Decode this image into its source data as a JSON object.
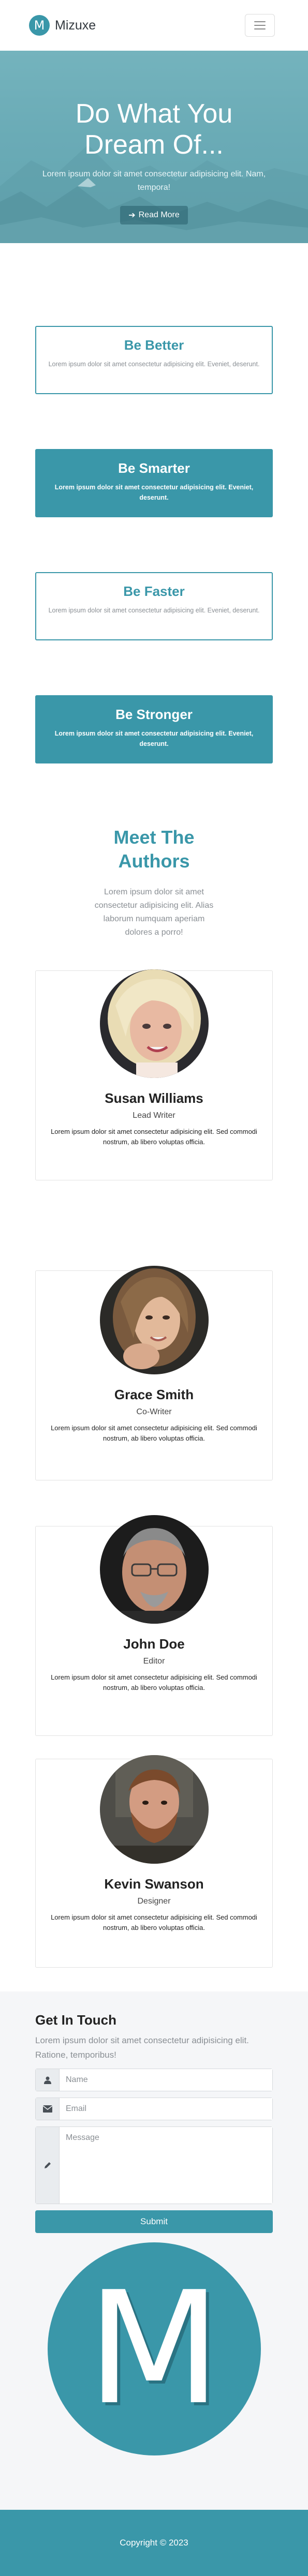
{
  "navbar": {
    "logo_letter": "M",
    "brand": "Mizuxe",
    "colors": {
      "brand": "#3a97a9"
    }
  },
  "hero": {
    "title": "Do What You Dream Of...",
    "subtitle": "Lorem ipsum dolor sit amet consectetur adipisicing elit. Nam, tempora!",
    "button_icon": "arrow-right-icon",
    "button_label": "Read More"
  },
  "features": [
    {
      "title": "Be Better",
      "text": "Lorem ipsum dolor sit amet consectetur adipisicing elit. Eveniet, deserunt.",
      "style": "outline"
    },
    {
      "title": "Be Smarter",
      "text": "Lorem ipsum dolor sit amet consectetur adipisicing elit. Eveniet, deserunt.",
      "style": "filled"
    },
    {
      "title": "Be Faster",
      "text": "Lorem ipsum dolor sit amet consectetur adipisicing elit. Eveniet, deserunt.",
      "style": "outline"
    },
    {
      "title": "Be Stronger",
      "text": "Lorem ipsum dolor sit amet consectetur adipisicing elit. Eveniet, deserunt.",
      "style": "filled"
    }
  ],
  "authors": {
    "title": "Meet The Authors",
    "subtitle": "Lorem ipsum dolor sit amet consectetur adipisicing elit. Alias laborum numquam aperiam dolores a porro!",
    "list": [
      {
        "name": "Susan Williams",
        "role": "Lead Writer",
        "bio": "Lorem ipsum dolor sit amet consectetur adipisicing elit. Sed commodi nostrum, ab libero voluptas officia."
      },
      {
        "name": "Grace Smith",
        "role": "Co-Writer",
        "bio": "Lorem ipsum dolor sit amet consectetur adipisicing elit. Sed commodi nostrum, ab libero voluptas officia."
      },
      {
        "name": "John Doe",
        "role": "Editor",
        "bio": "Lorem ipsum dolor sit amet consectetur adipisicing elit. Sed commodi nostrum, ab libero voluptas officia."
      },
      {
        "name": "Kevin Swanson",
        "role": "Designer",
        "bio": "Lorem ipsum dolor sit amet consectetur adipisicing elit. Sed commodi nostrum, ab libero voluptas officia."
      }
    ]
  },
  "contact": {
    "title": "Get In Touch",
    "subtitle": "Lorem ipsum dolor sit amet consectetur adipisicing elit. Ratione, temporibus!",
    "name_placeholder": "Name",
    "email_placeholder": "Email",
    "message_placeholder": "Message",
    "name_icon": "user-icon",
    "email_icon": "envelope-icon",
    "message_icon": "pencil-icon",
    "submit_label": "Submit",
    "big_logo_letter": "M"
  },
  "footer": {
    "copyright": "Copyright © 2023"
  }
}
